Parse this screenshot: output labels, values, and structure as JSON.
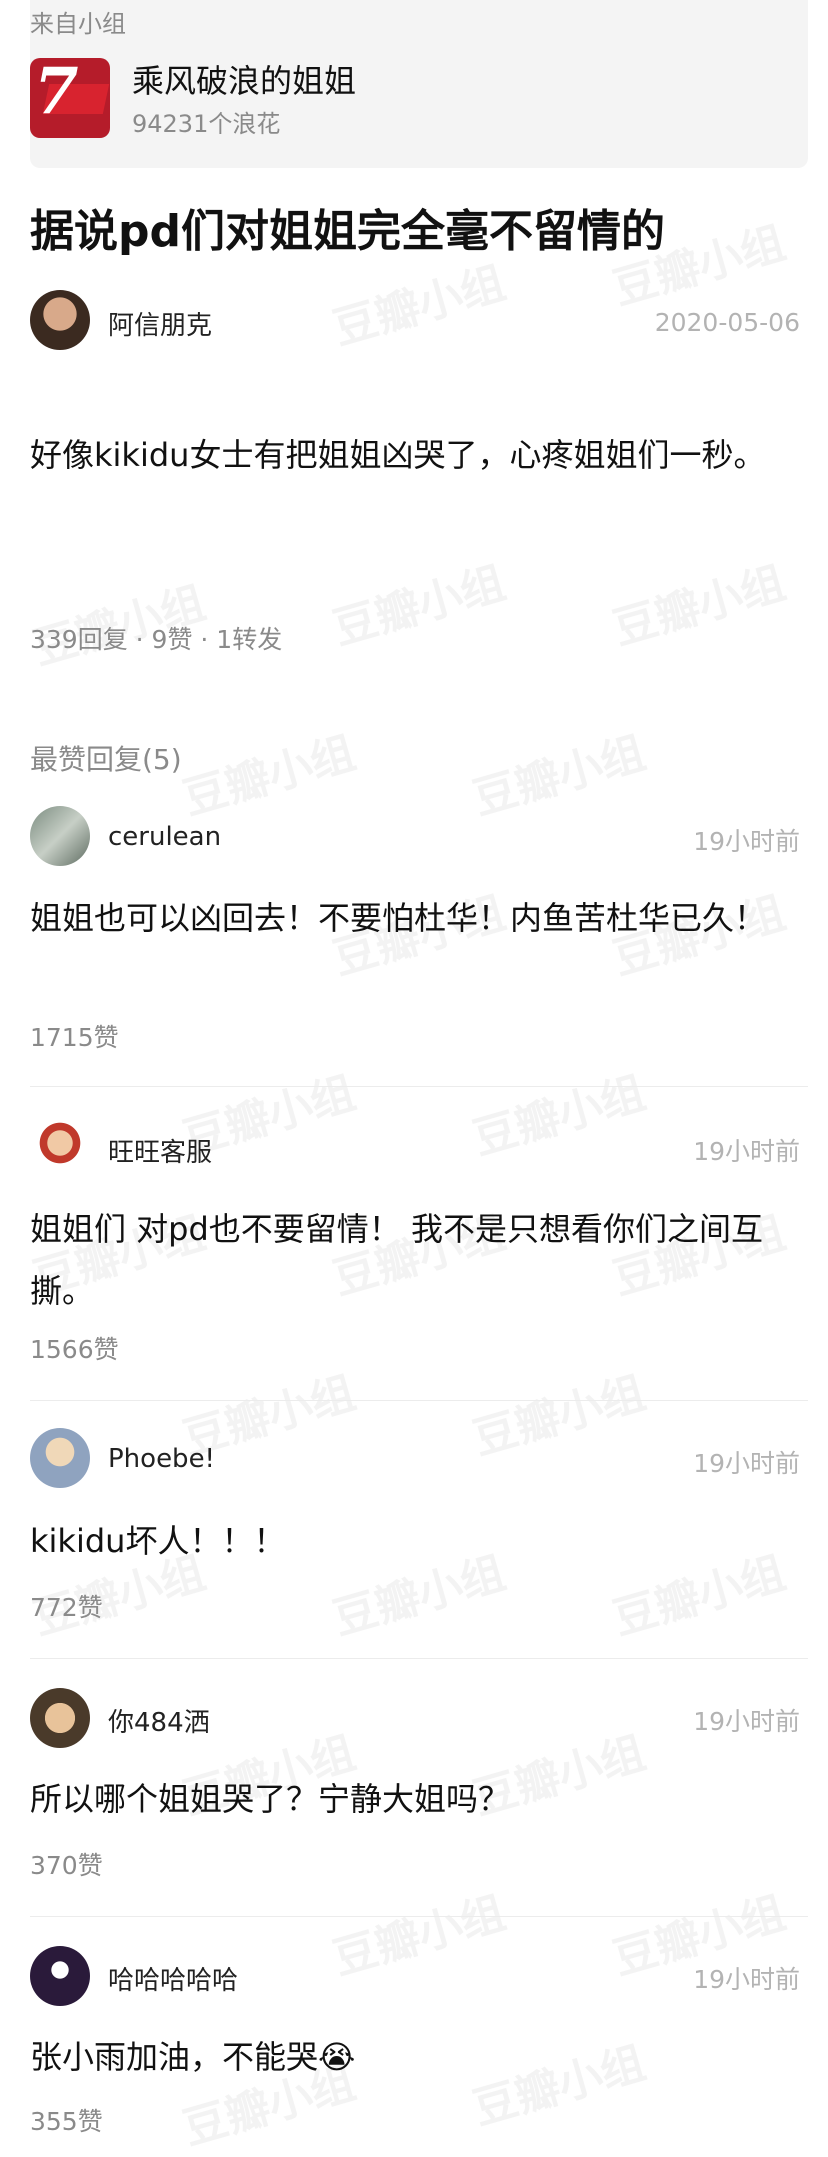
{
  "group": {
    "from_label": "来自小组",
    "name": "乘风破浪的姐姐",
    "members": "94231个浪花",
    "logo_icon": "group-logo-icon"
  },
  "post": {
    "title": "据说pd们对姐姐完全毫不留情的",
    "author": "阿信朋克",
    "date": "2020-05-06",
    "body": "好像kikidu女士有把姐姐凶哭了，心疼姐姐们一秒。",
    "stats": "339回复 · 9赞 · 1转发"
  },
  "replies_section": {
    "title": "最赞回复(5)"
  },
  "comments": [
    {
      "author": "cerulean",
      "time": "19小时前",
      "text": "姐姐也可以凶回去！不要怕杜华！内鱼苦杜华已久！",
      "likes": "1715赞"
    },
    {
      "author": "旺旺客服",
      "time": "19小时前",
      "text": "姐姐们 对pd也不要留情！ 我不是只想看你们之间互撕。",
      "likes": "1566赞"
    },
    {
      "author": "Phoebe!",
      "time": "19小时前",
      "text": "kikidu坏人！！！",
      "likes": "772赞"
    },
    {
      "author": "你484洒",
      "time": "19小时前",
      "text": "所以哪个姐姐哭了？宁静大姐吗？",
      "likes": "370赞"
    },
    {
      "author": "哈哈哈哈哈",
      "time": "19小时前",
      "text": "张小雨加油，不能哭😭",
      "likes": "355赞"
    }
  ],
  "watermark": {
    "text": "豆瓣小组"
  },
  "colors": {
    "brand": "#b51c2a",
    "text": "#111111",
    "muted": "#8a8a8a",
    "time": "#b3b3b3"
  }
}
